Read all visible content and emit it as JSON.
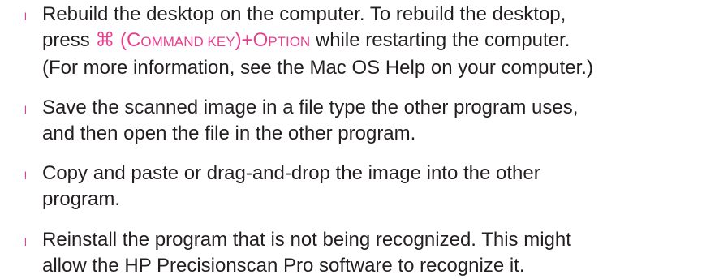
{
  "bullet_glyph": "l",
  "accent_color": "#e83e8c",
  "items": [
    {
      "line1": "Rebuild the desktop on the computer. To rebuild the desktop,",
      "line2_press": "press",
      "command_symbol": "⌘",
      "command_open": "(",
      "command_c": "C",
      "command_rest": "OMMAND KEY",
      "command_close": ")+",
      "option_o": "O",
      "option_rest": "PTION",
      "line2_tail": "while restarting the computer.",
      "line3": "(For more information, see the Mac OS Help on your computer.)"
    },
    {
      "line1": "Save the scanned image in a file type the other program uses,",
      "line2": "and then open the file in the other program."
    },
    {
      "line1": "Copy and paste or drag-and-drop the image into the other",
      "line2": "program."
    },
    {
      "line1": "Reinstall the program that is not being recognized. This might",
      "line2": "allow the HP Precisionscan Pro software to recognize it."
    }
  ]
}
